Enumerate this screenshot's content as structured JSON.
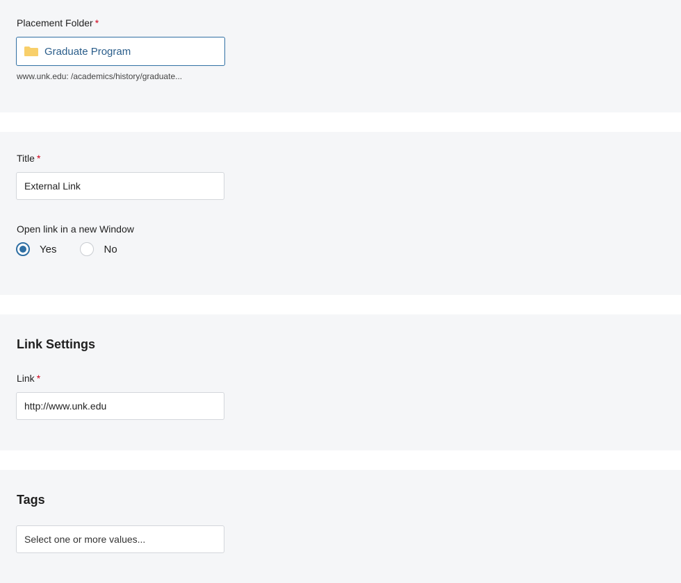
{
  "placement_folder": {
    "label": "Placement Folder",
    "required_mark": "*",
    "folder_name": "Graduate Program",
    "path": "www.unk.edu: /academics/history/graduate..."
  },
  "title_field": {
    "label": "Title",
    "required_mark": "*",
    "value": "External Link"
  },
  "new_window": {
    "label": "Open link in a new Window",
    "options": [
      {
        "label": "Yes",
        "checked": true
      },
      {
        "label": "No",
        "checked": false
      }
    ]
  },
  "link_settings": {
    "heading": "Link Settings",
    "link_label": "Link",
    "required_mark": "*",
    "link_value": "http://www.unk.edu"
  },
  "tags": {
    "heading": "Tags",
    "placeholder": "Select one or more values..."
  },
  "colors": {
    "panel_bg": "#f5f6f8",
    "accent": "#2f6fa3",
    "required": "#d0021b",
    "folder": "#f8cf6a"
  },
  "icons": {
    "folder": "folder-icon"
  }
}
